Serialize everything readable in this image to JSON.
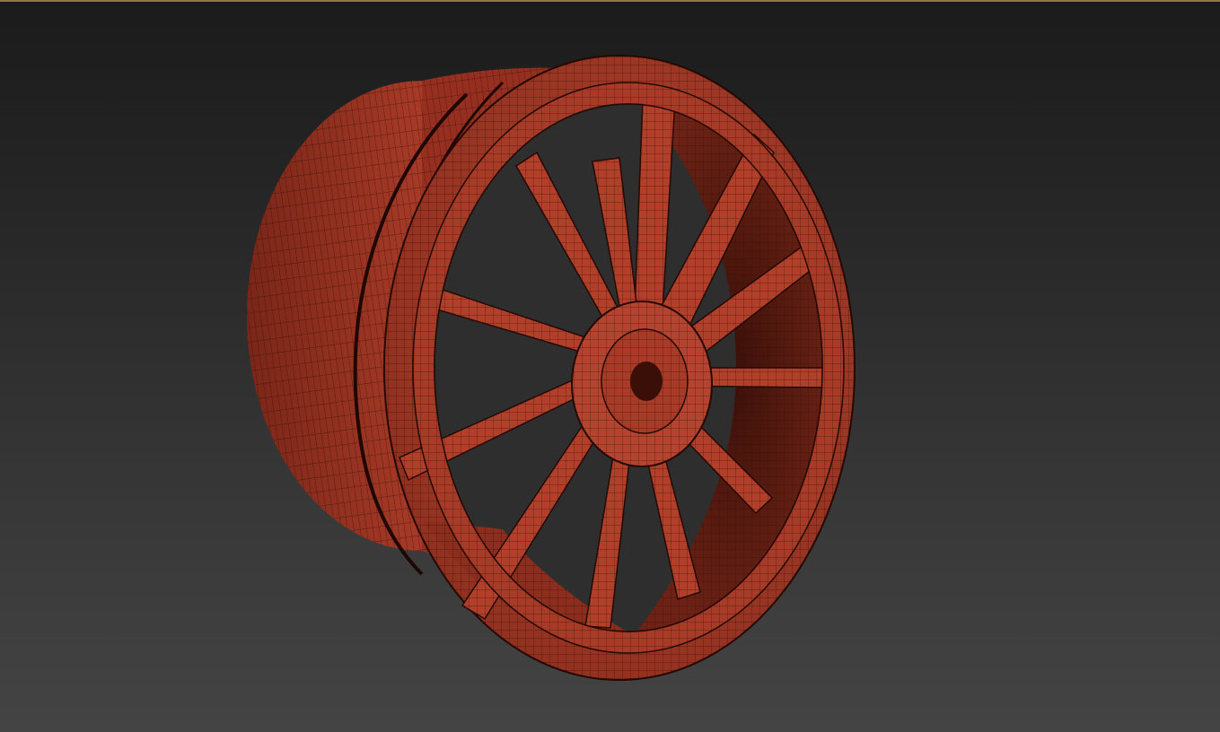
{
  "viewport": {
    "active_border_color": "#8a7a3a",
    "background_top": "#1b1b1b",
    "background_bottom": "#444444"
  },
  "model": {
    "name_icon": "wheel-rim-mesh",
    "base_color": "#b2412c",
    "wire_color": "#2a0c06",
    "spoke_count": 12
  }
}
